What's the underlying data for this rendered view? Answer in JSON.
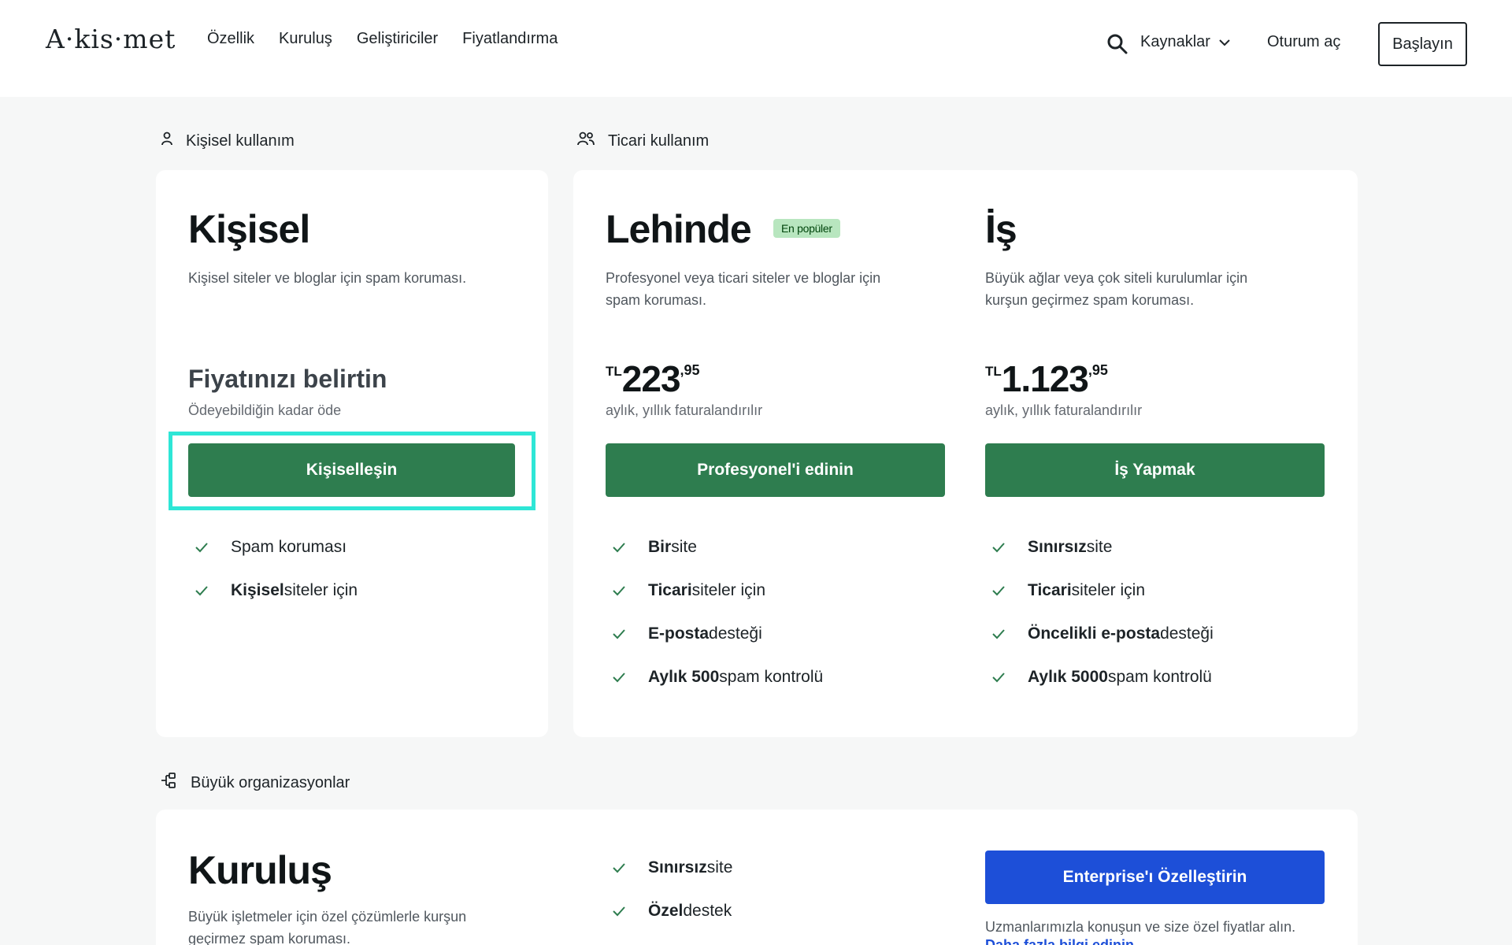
{
  "header": {
    "logo": "A·kis·met",
    "nav": [
      "Özellik",
      "Kuruluş",
      "Geliştiriciler",
      "Fiyatlandırma"
    ],
    "resources": "Kaynaklar",
    "login": "Oturum aç",
    "start": "Başlayın"
  },
  "sections": {
    "personal_label": "Kişisel kullanım",
    "commercial_label": "Ticari kullanım",
    "large_label": "Büyük organizasyonlar"
  },
  "plans": {
    "personal": {
      "title": "Kişisel",
      "desc": "Kişisel siteler ve bloglar için spam koruması.",
      "price_heading": "Fiyatınızı belirtin",
      "price_sub": "Ödeyebildiğin kadar öde",
      "button": "Kişiselleşin",
      "features": [
        {
          "bold": "",
          "text": "Spam koruması"
        },
        {
          "bold": "Kişisel",
          "text": " siteler için"
        }
      ]
    },
    "pro": {
      "title": "Lehinde",
      "badge": "En popüler",
      "desc_1": "Profesyonel veya ticari siteler ve bloglar için",
      "desc_2": "spam koruması.",
      "currency": "TL",
      "price_main": "223",
      "price_dec": ",95",
      "price_sub": "aylık, yıllık faturalandırılır",
      "button": "Profesyonel'i edinin",
      "features": [
        {
          "bold": "Bir",
          "text": " site"
        },
        {
          "bold": "Ticari",
          "text": " siteler için"
        },
        {
          "bold": "E-posta",
          "text": " desteği"
        },
        {
          "bold": "Aylık 500",
          "text": " spam kontrolü"
        }
      ]
    },
    "business": {
      "title": "İş",
      "desc_1": "Büyük ağlar veya çok siteli kurulumlar için",
      "desc_2": "kurşun geçirmez spam koruması.",
      "currency": "TL",
      "price_main": "1.123",
      "price_dec": ",95",
      "price_sub": "aylık, yıllık faturalandırılır",
      "button": "İş Yapmak",
      "features": [
        {
          "bold": "Sınırsız",
          "text": " site"
        },
        {
          "bold": "Ticari",
          "text": " siteler için"
        },
        {
          "bold": "Öncelikli e-posta",
          "text": " desteği"
        },
        {
          "bold": "Aylık 5000",
          "text": " spam kontrolü"
        }
      ]
    },
    "enterprise": {
      "title": "Kuruluş",
      "desc_1": "Büyük işletmeler için özel çözümlerle kurşun",
      "desc_2": "geçirmez spam koruması.",
      "features": [
        {
          "bold": "Sınırsız",
          "text": " site"
        },
        {
          "bold": "Özel",
          "text": " destek"
        }
      ],
      "button": "Enterprise'ı Özelleştirin",
      "note": "Uzmanlarımızla konuşun ve size özel fiyatlar alın.",
      "link": "Daha fazla bilgi edinin"
    }
  },
  "colors": {
    "green_button": "#2e7d4f",
    "blue_button": "#1d4fd8",
    "highlight": "#2ee6d6",
    "badge_bg": "#b8e6bf"
  }
}
